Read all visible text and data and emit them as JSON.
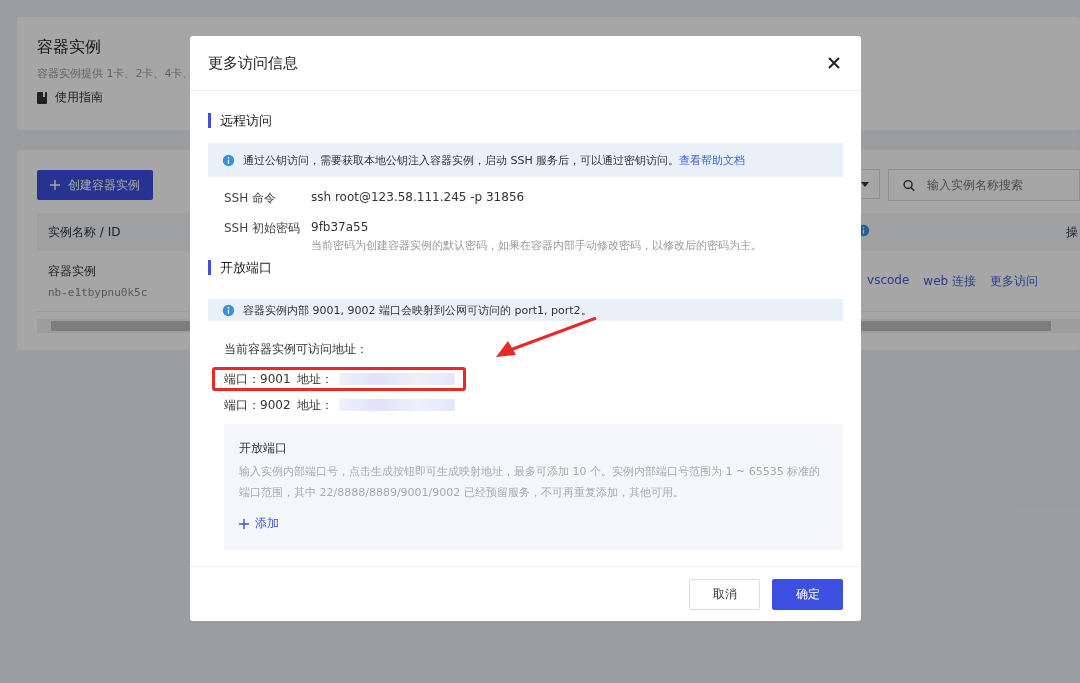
{
  "page": {
    "title": "容器实例",
    "description": "容器实例提供 1卡、2卡、4卡、",
    "guide_link": "使用指南",
    "create_button": "创建容器实例",
    "search": {
      "placeholder": "输入实例名称搜索"
    },
    "table": {
      "columns": [
        {
          "kind": "text",
          "label": "实例名称 / ID"
        },
        {
          "kind": "info"
        },
        {
          "kind": "text",
          "label": "操"
        }
      ],
      "rows": [
        {
          "name": "容器实例",
          "id": "nb-e1tbypnu0k5c",
          "actions": [
            "vscode",
            "web 连接",
            "更多访问"
          ]
        }
      ]
    }
  },
  "modal": {
    "title": "更多访问信息",
    "remote": {
      "heading": "远程访问",
      "notice": "通过公钥访问，需要获取本地公钥注入容器实例，启动 SSH 服务后，可以通过密钥访问。",
      "notice_link": "查看帮助文档",
      "fields": [
        {
          "label": "SSH 命令",
          "value": "ssh root@123.58.111.245 -p 31856"
        },
        {
          "label": "SSH 初始密码",
          "value": "9fb37a55",
          "hint": "当前密码为创建容器实例的默认密码，如果在容器内部手动修改密码，以修改后的密码为主。"
        }
      ]
    },
    "ports": {
      "heading": "开放端口",
      "notice": "容器实例内部 9001, 9002 端口会映射到公网可访问的 port1, port2。",
      "address_label": "当前容器实例可访问地址：",
      "rows": [
        {
          "port": "端口：9001",
          "address_label": "地址：",
          "highlighted": true
        },
        {
          "port": "端口：9002",
          "address_label": "地址：",
          "highlighted": false
        }
      ],
      "panel": {
        "title": "开放端口",
        "description": "输入实例内部端口号，点击生成按钮即可生成映射地址，最多可添加 10 个。实例内部端口号范围为 1 ~ 65535 标准的端口范围，其中 22/8888/8889/9001/9002 已经预留服务，不可再重复添加，其他可用。",
        "add_button": "添加"
      }
    },
    "buttons": [
      {
        "label": "取消",
        "kind": "secondary"
      },
      {
        "label": "确定",
        "kind": "primary"
      }
    ]
  }
}
